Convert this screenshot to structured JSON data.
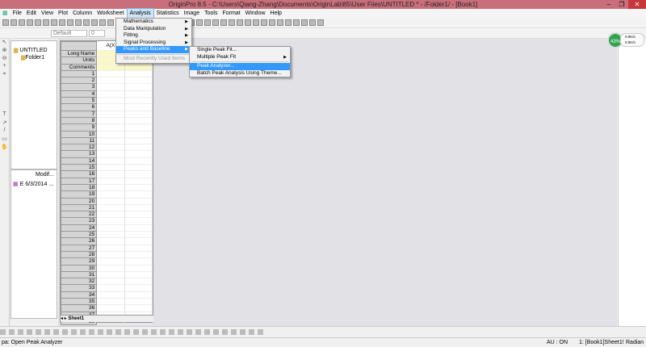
{
  "title": "OriginPro 8.5 - C:\\Users\\Qiang-Zhang\\Documents\\OriginLab\\85\\User Files\\UNTITLED * - /Folder1/ - [Book1]",
  "menubar": [
    "File",
    "Edit",
    "View",
    "Plot",
    "Column",
    "Worksheet",
    "Analysis",
    "Statistics",
    "Image",
    "Tools",
    "Format",
    "Window",
    "Help"
  ],
  "format": {
    "style": "Default",
    "size": "0"
  },
  "analysis_menu": [
    {
      "label": "Mathematics",
      "sub": true
    },
    {
      "label": "Data Manipulation",
      "sub": true
    },
    {
      "label": "Fitting",
      "sub": true
    },
    {
      "label": "Signal Processing",
      "sub": true
    },
    {
      "label": "Peaks and Baseline",
      "sub": true
    },
    {
      "label": "Most Recently Used Items",
      "sub": false
    }
  ],
  "peaks_menu": [
    {
      "label": "Single Peak Fit...",
      "sub": false
    },
    {
      "label": "Multiple Peak Fit",
      "sub": true
    },
    {
      "label": "Peak Analyzer...",
      "sub": false
    },
    {
      "label": "Batch Peak Analysis Using Theme...",
      "sub": false
    }
  ],
  "project": {
    "root": "UNTITLED",
    "folder": "Folder1",
    "col_header": "Modif...",
    "item_name": "E",
    "item_date": "6/3/2014 ..."
  },
  "sheet": {
    "col_label": "A(X",
    "headers": [
      "Long Name",
      "Units",
      "Comments"
    ],
    "row_count": 38,
    "tab": "Sheet1"
  },
  "gauge": {
    "percent": "43%",
    "up": "0.0K/s",
    "down": "0.0K/s"
  },
  "status": {
    "message": "pa: Open Peak Analyzer",
    "au": "AU : ON",
    "book": "1: [Book1]Sheet1!",
    "angle": "Radian"
  },
  "colors": {
    "title": "#c96f7b",
    "highlight": "#3399ff"
  }
}
